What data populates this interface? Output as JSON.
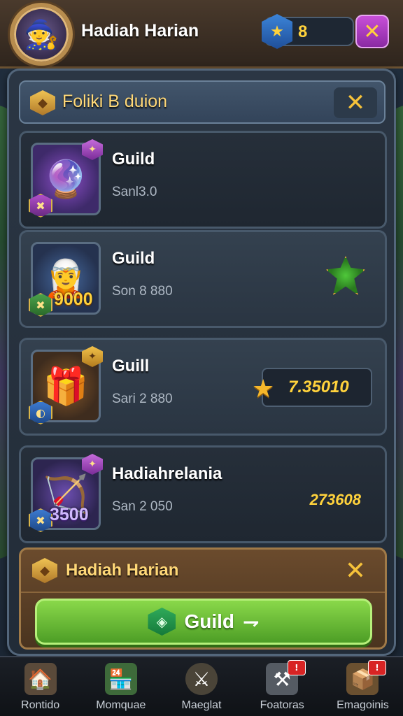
{
  "topbar": {
    "title": "Hadiah Harian",
    "currency_value": "8",
    "currency_icon": "shield-star-icon",
    "close_icon": "close-icon"
  },
  "panel": {
    "header_title": "Foliki B duion",
    "header_close_icon": "close-icon"
  },
  "rows": [
    {
      "title": "Guild",
      "subtitle": "Sanl3.0",
      "icon": "magic-gauntlet-icon",
      "amount": ""
    },
    {
      "title": "Guild",
      "subtitle": "Son 8 880",
      "icon": "hero-portrait-icon",
      "amount": "9000",
      "reward_icon": "green-gem-icon"
    },
    {
      "title": "Guill",
      "subtitle": "Sari 2 880",
      "icon": "treasure-chest-icon",
      "amount": "",
      "reward_value": "7.35010",
      "reward_icon": "gold-star-icon"
    },
    {
      "title": "Hadiahrelania",
      "subtitle": "San 2 050",
      "icon": "crossbow-icon",
      "amount": "3500",
      "reward_value": "273608"
    }
  ],
  "claim": {
    "title": "Hadiah Harian",
    "button_label": "Guild",
    "button_icon": "green-gem-icon"
  },
  "nav": [
    {
      "label": "Rontido",
      "icon": "home-icon",
      "alert": ""
    },
    {
      "label": "Momquae",
      "icon": "shop-icon",
      "alert": ""
    },
    {
      "label": "Maeglat",
      "icon": "sword-icon",
      "alert": ""
    },
    {
      "label": "Foatoras",
      "icon": "forge-icon",
      "alert": "!"
    },
    {
      "label": "Emagoinis",
      "icon": "chest-icon",
      "alert": "!"
    }
  ],
  "colors": {
    "accent_gold": "#ffd23c",
    "claim_green": "#6cc036",
    "panel_bg": "#2b3644"
  }
}
